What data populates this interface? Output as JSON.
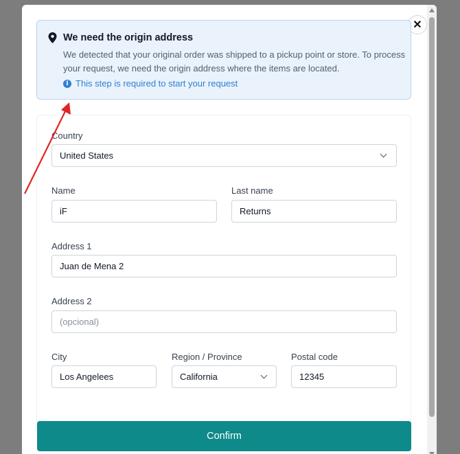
{
  "notice": {
    "title": "We need the origin address",
    "description": "We detected that your original order was shipped to a pickup point or store. To process your request, we need the origin address where the items are located.",
    "required_note": "This step is required to start your request",
    "icon": "map-pin-icon",
    "info_icon": "info-icon",
    "info_glyph": "i"
  },
  "close": {
    "icon": "close-icon",
    "glyph": "✕"
  },
  "form": {
    "country": {
      "label": "Country",
      "value": "United States"
    },
    "name": {
      "label": "Name",
      "value": "iF"
    },
    "last_name": {
      "label": "Last name",
      "value": "Returns"
    },
    "address1": {
      "label": "Address 1",
      "value": "Juan de Mena 2"
    },
    "address2": {
      "label": "Address 2",
      "value": "",
      "placeholder": "(opcional)"
    },
    "city": {
      "label": "City",
      "value": "Los Angelees"
    },
    "region": {
      "label": "Region / Province",
      "value": "California"
    },
    "postal": {
      "label": "Postal code",
      "value": "12345"
    }
  },
  "confirm_label": "Confirm",
  "colors": {
    "accent": "#0e8a8a",
    "notice_bg": "#eaf2fc",
    "info_blue": "#2f7fd3",
    "annotation_arrow": "#e02424"
  }
}
